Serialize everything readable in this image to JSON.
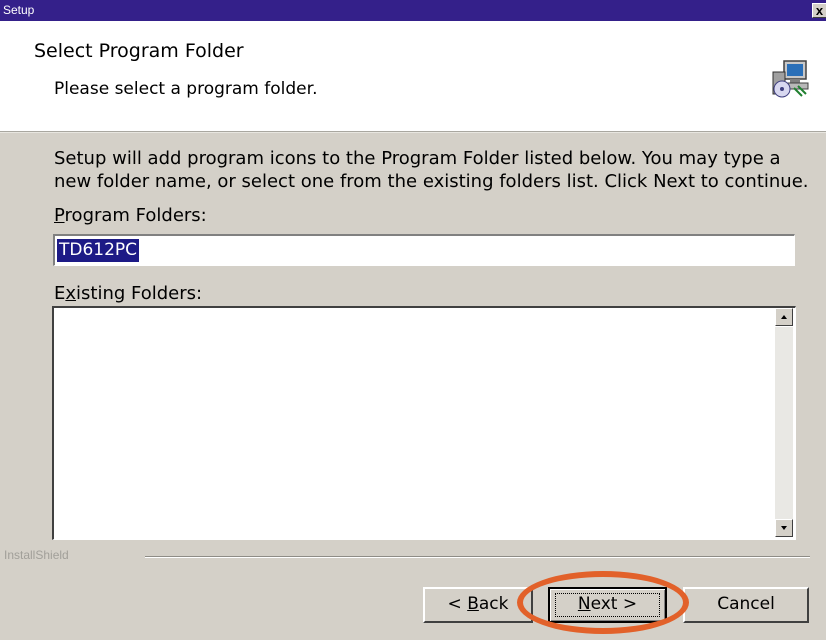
{
  "window": {
    "title": "Setup",
    "close_label": "x"
  },
  "header": {
    "title": "Select Program Folder",
    "subtitle": "Please select a program folder.",
    "icon": "setup-computer-icon"
  },
  "body": {
    "description": "Setup will add program icons to the Program Folder listed below.  You may type a new folder name, or select one from the existing folders list.  Click Next to continue.",
    "program_folders_label": {
      "mnemonic": "P",
      "rest": "rogram Folders:"
    },
    "program_folder_value": "TD612PC",
    "existing_folders_label": {
      "pre": "E",
      "mnemonic": "x",
      "rest": "isting Folders:"
    },
    "existing_folders_items": []
  },
  "footer": {
    "brand": "InstallShield",
    "back_button": {
      "pre": "< ",
      "mnemonic": "B",
      "rest": "ack"
    },
    "next_button": {
      "mnemonic": "N",
      "rest": "ext >"
    },
    "cancel_button": "Cancel"
  },
  "annotation": {
    "color": "#e2612a",
    "target": "next-button"
  },
  "colors": {
    "titlebar": "#34208a",
    "selection": "#1d1a86",
    "dialog": "#d4d0c8"
  }
}
